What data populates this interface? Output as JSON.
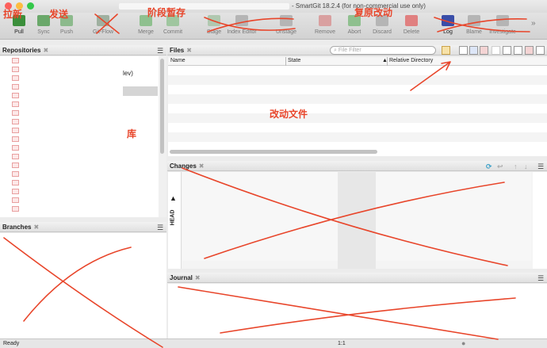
{
  "window": {
    "title": "- SmartGit 18.2.4 (for non-commercial use only)"
  },
  "toolbar": [
    {
      "label": "Pull",
      "color": "#3b8f3b",
      "active": true
    },
    {
      "label": "Sync",
      "color": "#6aa86a",
      "active": false
    },
    {
      "label": "Push",
      "color": "#8cba8c",
      "active": false
    },
    {
      "label": "Git-Flow",
      "color": "#9fb0a0",
      "active": false
    },
    {
      "label": "Merge",
      "color": "#8fc08f",
      "active": false
    },
    {
      "label": "Commit",
      "color": "#9fc69f",
      "active": false
    },
    {
      "label": "Stage",
      "color": "#b0c8b0",
      "active": false
    },
    {
      "label": "Index Editor",
      "color": "#b5b5b5",
      "active": false
    },
    {
      "label": "Unstage",
      "color": "#b5b5b5",
      "active": false
    },
    {
      "label": "Remove",
      "color": "#d9a0a0",
      "active": false
    },
    {
      "label": "Abort",
      "color": "#8fc08f",
      "active": false
    },
    {
      "label": "Discard",
      "color": "#b5b5b5",
      "active": false
    },
    {
      "label": "Delete",
      "color": "#e08080",
      "active": false
    },
    {
      "label": "Log",
      "color": "#3a4ea8",
      "active": true
    },
    {
      "label": "Blame",
      "color": "#b5b5b5",
      "active": false
    },
    {
      "label": "Investigate",
      "color": "#b5b5b5",
      "active": false
    }
  ],
  "toolbar_overflow": "»",
  "repositories": {
    "title": "Repositories",
    "fragment": "lev)"
  },
  "branches": {
    "title": "Branches"
  },
  "files": {
    "title": "Files",
    "filter_placeholder": "File Filter",
    "columns": {
      "name": "Name",
      "state": "State",
      "rel_dir": "Relative Directory"
    }
  },
  "changes": {
    "title": "Changes",
    "head_label": "HEAD"
  },
  "journal": {
    "title": "Journal"
  },
  "status": {
    "left": "Ready",
    "center": "1:1"
  },
  "annotations": {
    "pull": "拉新",
    "push": "发送",
    "stage": "阶段暂存",
    "discard": "复原改动",
    "repo": "库",
    "files": "改动文件"
  },
  "annotation_color": "#e8452a"
}
